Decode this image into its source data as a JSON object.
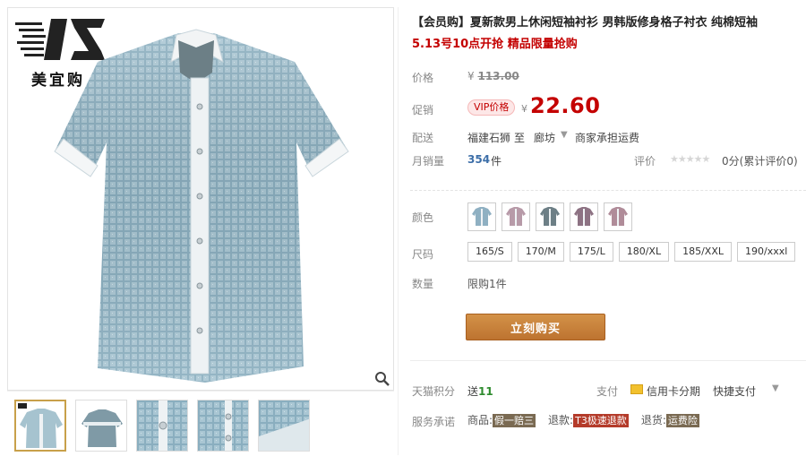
{
  "brand": {
    "name": "美宜购"
  },
  "product": {
    "title": "【会员购】夏新款男上休闲短袖衬衫 男韩版修身格子衬衣 纯棉短袖",
    "subtitle": "5.13号10点开抢 精品限量抢购"
  },
  "price": {
    "label": "价格",
    "currency": "¥",
    "original": "113.00",
    "promo_label": "促销",
    "vip_badge": "VIP价格",
    "current": "22.60"
  },
  "shipping": {
    "label": "配送",
    "from": "福建石狮",
    "to_word": "至",
    "city": "廊坊",
    "fee_text": "商家承担运费"
  },
  "sales": {
    "label": "月销量",
    "count": "354",
    "unit": "件",
    "rating_label": "评价",
    "stars": "★★★★★",
    "rating_text": "0分(累计评价0)"
  },
  "colors": {
    "label": "颜色",
    "swatches": [
      "#8fb0c2",
      "#b79aa8",
      "#6d7f86",
      "#8d7283",
      "#b08c99"
    ]
  },
  "sizes": {
    "label": "尺码",
    "options": [
      "165/S",
      "170/M",
      "175/L",
      "180/XL",
      "185/XXL",
      "190/xxxl"
    ]
  },
  "quantity": {
    "label": "数量",
    "text": "限购1件"
  },
  "buy_button": "立刻购买",
  "points": {
    "label": "天猫积分",
    "prefix": "送",
    "value": "11"
  },
  "payment": {
    "label": "支付",
    "installment": "信用卡分期",
    "quick": "快捷支付"
  },
  "service": {
    "label": "服务承诺",
    "items": [
      {
        "name": "商品:",
        "tag": "假一赔三"
      },
      {
        "name": "退款:",
        "tag": "T3极速退款"
      },
      {
        "name": "退货:",
        "tag": "运费险"
      }
    ]
  },
  "icons": {
    "zoom": "magnifier-icon",
    "logo": "brand-logo-icon",
    "card": "credit-card-icon",
    "dropdown": "chevron-down-icon"
  },
  "theme": {
    "price_red": "#c40000",
    "buy_orange": "#c8813a",
    "selected_border": "#c8a04a"
  }
}
